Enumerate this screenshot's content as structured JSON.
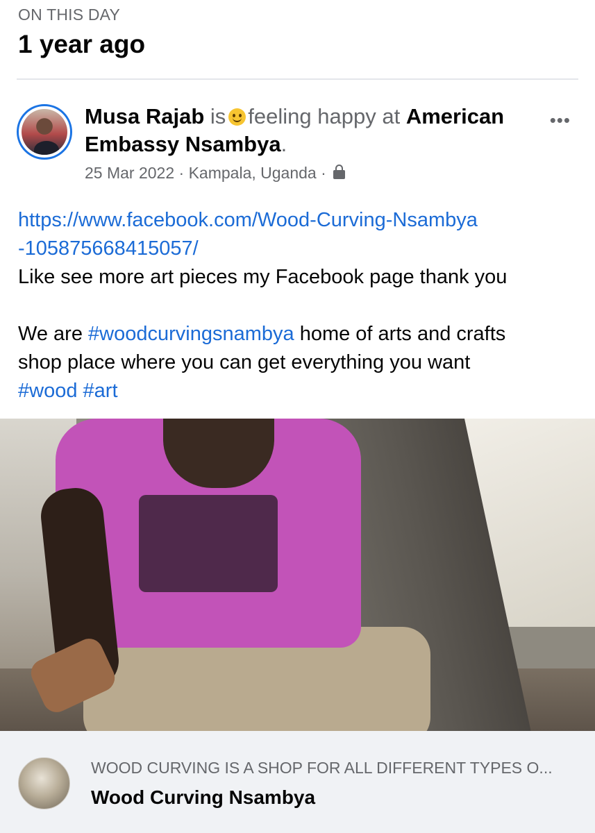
{
  "memory": {
    "label": "ON THIS DAY",
    "time_ago": "1 year ago"
  },
  "post": {
    "author": "Musa Rajab",
    "is_word": "is",
    "feeling_icon": "smiley-emoji",
    "feeling_text": "feeling happy at",
    "place_line1": "American",
    "place_line2": "Embassy Nsambya",
    "period": ".",
    "date": "25 Mar 2022",
    "sep": "·",
    "location": "Kampala, Uganda",
    "privacy_icon": "lock-icon",
    "more_icon": "•••",
    "link_line1": "https://www.facebook.com/Wood-Curving-Nsambya",
    "link_line2": "-105875668415057/",
    "line_like": "Like see more art pieces my Facebook page thank you",
    "we_are": "We are",
    "hashtag_main": "#woodcurvingsnambya",
    "line_home": "home of arts and crafts",
    "line_shop": "shop place where you can get everything you want",
    "hashtag_wood": "#wood",
    "hashtag_art": "#art",
    "photo_description": ""
  },
  "shared_link": {
    "description": "WOOD CURVING IS A SHOP FOR ALL DIFFERENT TYPES O...",
    "title": "Wood Curving Nsambya"
  },
  "colors": {
    "link": "#1b6bd6",
    "secondary_text": "#65676b",
    "avatar_ring": "#1b74e4",
    "card_bg": "#f0f2f5"
  }
}
